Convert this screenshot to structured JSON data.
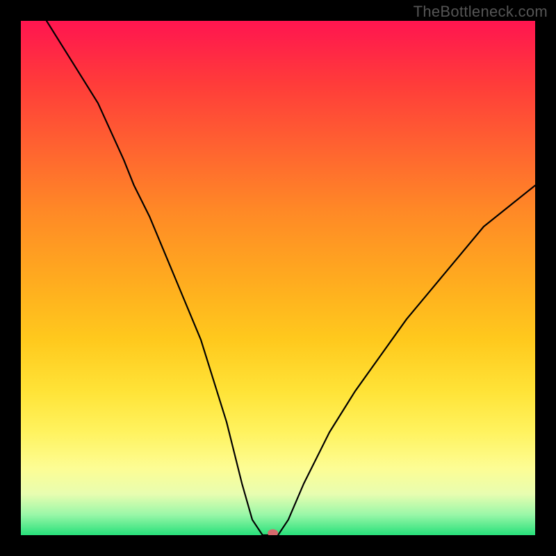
{
  "watermark": "TheBottleneck.com",
  "chart_data": {
    "type": "line",
    "title": "",
    "xlabel": "",
    "ylabel": "",
    "xlim": [
      0,
      100
    ],
    "ylim": [
      0,
      100
    ],
    "grid": false,
    "legend": false,
    "background": "rainbow-gradient (red top → green bottom, value ≈ bottleneck %)",
    "series": [
      {
        "name": "bottleneck-curve",
        "x": [
          5,
          10,
          15,
          20,
          22,
          25,
          30,
          35,
          40,
          43,
          45,
          47,
          48,
          50,
          52,
          55,
          60,
          65,
          70,
          75,
          80,
          85,
          90,
          95,
          100
        ],
        "y": [
          100,
          92,
          84,
          73,
          68,
          62,
          50,
          38,
          22,
          10,
          3,
          0,
          0,
          0,
          3,
          10,
          20,
          28,
          35,
          42,
          48,
          54,
          60,
          64,
          68
        ]
      }
    ],
    "marker": {
      "x": 49,
      "y": 0,
      "color": "#d66a6d"
    },
    "gradient_stops": [
      {
        "pct": 0,
        "color": "#ff1550"
      },
      {
        "pct": 12,
        "color": "#ff3b3a"
      },
      {
        "pct": 25,
        "color": "#ff6430"
      },
      {
        "pct": 37,
        "color": "#ff8926"
      },
      {
        "pct": 50,
        "color": "#ffaa1f"
      },
      {
        "pct": 62,
        "color": "#ffc91d"
      },
      {
        "pct": 72,
        "color": "#ffe337"
      },
      {
        "pct": 80,
        "color": "#fff35f"
      },
      {
        "pct": 87,
        "color": "#fdfd94"
      },
      {
        "pct": 92,
        "color": "#e8fdb0"
      },
      {
        "pct": 96,
        "color": "#9af7a8"
      },
      {
        "pct": 100,
        "color": "#27e07a"
      }
    ]
  }
}
